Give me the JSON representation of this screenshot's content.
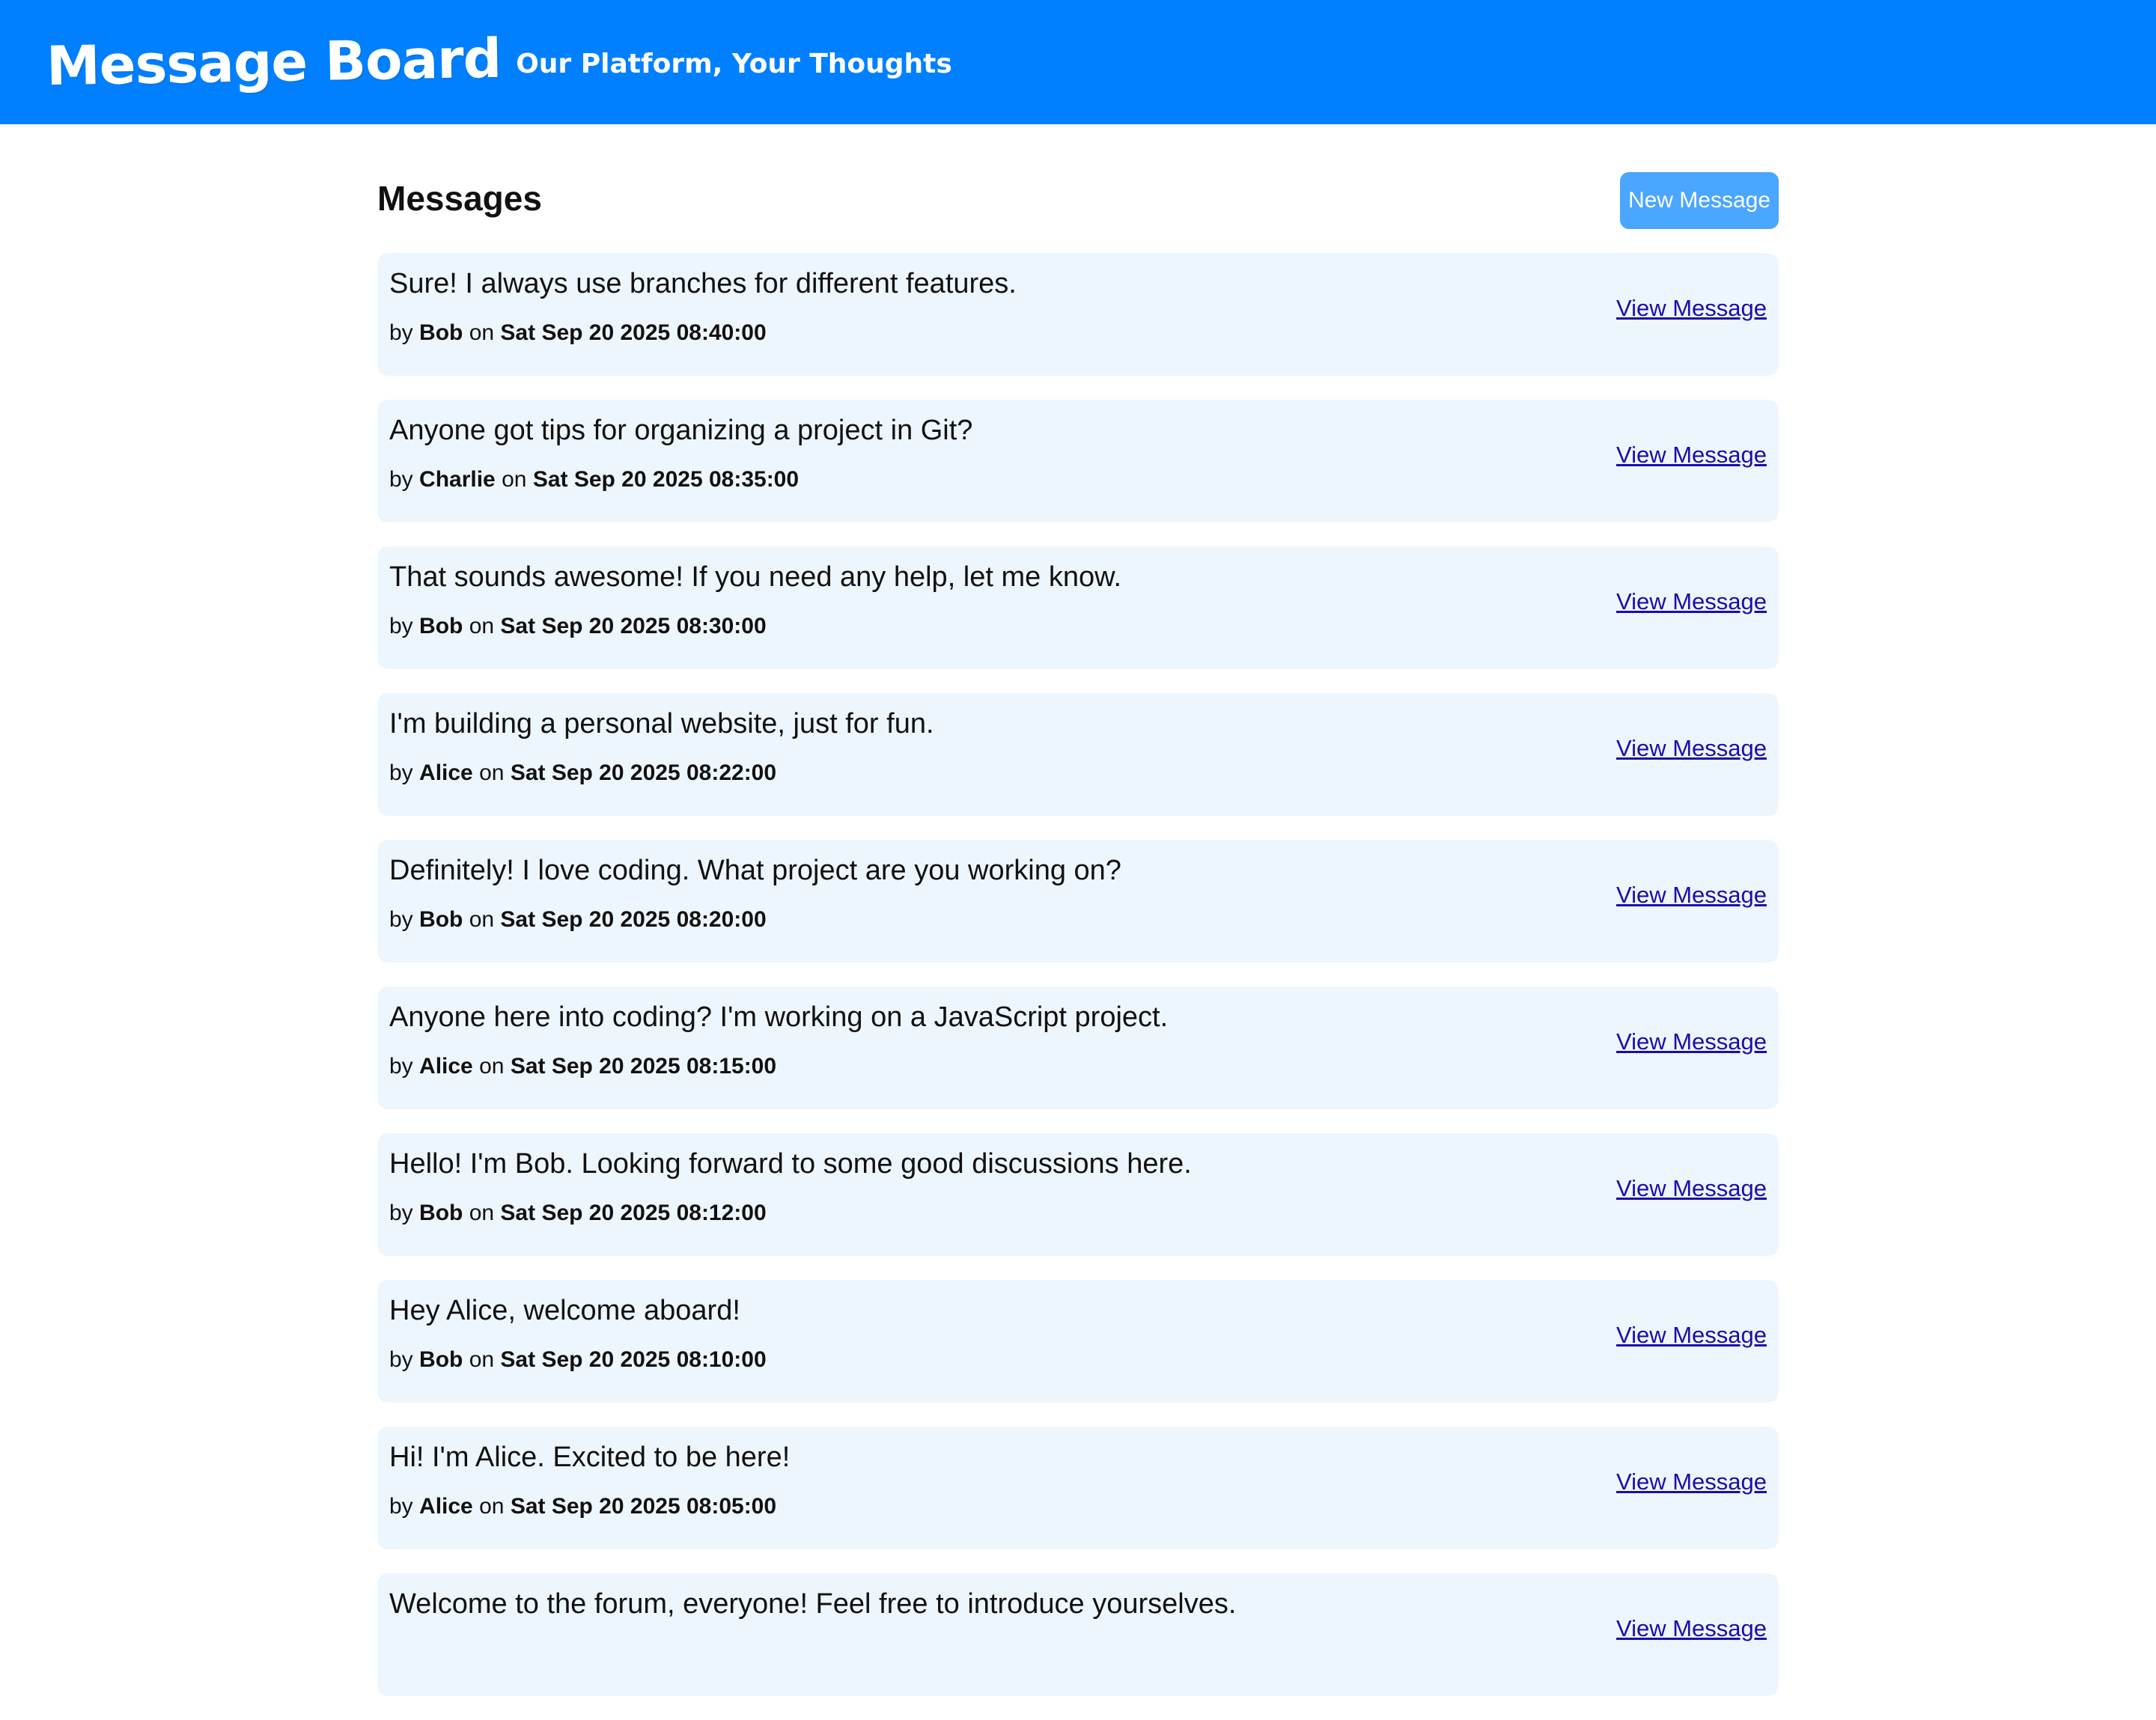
{
  "header": {
    "title": "Message Board",
    "tagline": "Our Platform, Your Thoughts"
  },
  "main": {
    "title": "Messages",
    "new_button": "New Message",
    "view_label": "View Message",
    "by_label": "by",
    "on_label": "on",
    "messages": [
      {
        "text": "Sure! I always use branches for different features.",
        "author": "Bob",
        "date": "Sat Sep 20 2025 08:40:00"
      },
      {
        "text": "Anyone got tips for organizing a project in Git?",
        "author": "Charlie",
        "date": "Sat Sep 20 2025 08:35:00"
      },
      {
        "text": "That sounds awesome! If you need any help, let me know.",
        "author": "Bob",
        "date": "Sat Sep 20 2025 08:30:00"
      },
      {
        "text": "I'm building a personal website, just for fun.",
        "author": "Alice",
        "date": "Sat Sep 20 2025 08:22:00"
      },
      {
        "text": "Definitely! I love coding. What project are you working on?",
        "author": "Bob",
        "date": "Sat Sep 20 2025 08:20:00"
      },
      {
        "text": "Anyone here into coding? I'm working on a JavaScript project.",
        "author": "Alice",
        "date": "Sat Sep 20 2025 08:15:00"
      },
      {
        "text": "Hello! I'm Bob. Looking forward to some good discussions here.",
        "author": "Bob",
        "date": "Sat Sep 20 2025 08:12:00"
      },
      {
        "text": "Hey Alice, welcome aboard!",
        "author": "Bob",
        "date": "Sat Sep 20 2025 08:10:00"
      },
      {
        "text": "Hi! I'm Alice. Excited to be here!",
        "author": "Alice",
        "date": "Sat Sep 20 2025 08:05:00"
      },
      {
        "text": "Welcome to the forum, everyone! Feel free to introduce yourselves."
      }
    ]
  }
}
